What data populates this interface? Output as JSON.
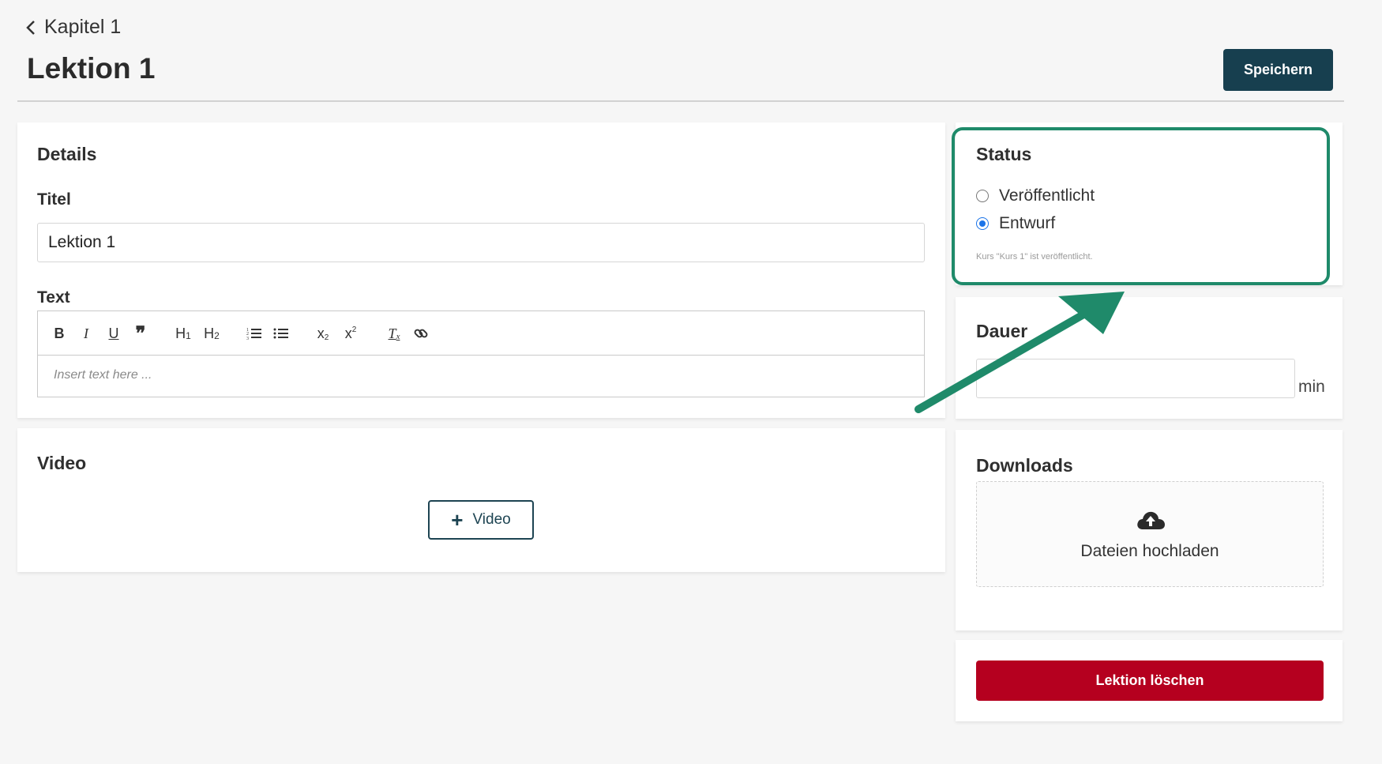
{
  "header": {
    "back_label": "Kapitel 1",
    "title": "Lektion 1",
    "save_label": "Speichern"
  },
  "details": {
    "heading": "Details",
    "title_label": "Titel",
    "title_value": "Lektion 1",
    "text_label": "Text",
    "editor_placeholder": "Insert text here ...",
    "toolbar": [
      "bold-icon",
      "italic-icon",
      "underline-icon",
      "blockquote-icon",
      "heading-1-icon",
      "heading-2-icon",
      "ordered-list-icon",
      "bullet-list-icon",
      "subscript-icon",
      "superscript-icon",
      "clear-format-icon",
      "link-icon"
    ]
  },
  "video": {
    "heading": "Video",
    "add_label": "Video"
  },
  "status": {
    "heading": "Status",
    "options": [
      {
        "label": "Veröffentlicht",
        "selected": false
      },
      {
        "label": "Entwurf",
        "selected": true
      }
    ],
    "note": "Kurs \"Kurs 1\" ist veröffentlicht."
  },
  "duration": {
    "heading": "Dauer",
    "value": "",
    "unit": "min"
  },
  "downloads": {
    "heading": "Downloads",
    "upload_label": "Dateien hochladen"
  },
  "delete_label": "Lektion löschen",
  "colors": {
    "primary": "#173f4f",
    "danger": "#b5001f",
    "highlight": "#1f8a6a",
    "radio_selected": "#1a73e8"
  }
}
